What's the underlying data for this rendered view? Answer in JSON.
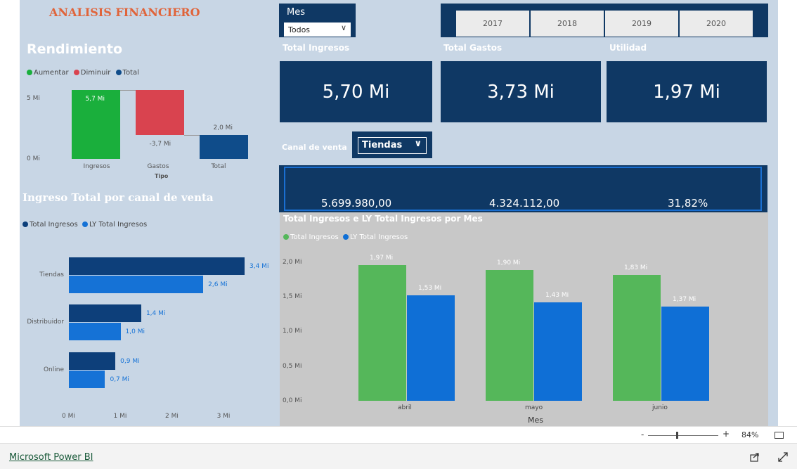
{
  "header": {
    "title": "ANALISIS  FINANCIERO"
  },
  "mes_slicer": {
    "label": "Mes",
    "selected": "Todos"
  },
  "years": [
    "2017",
    "2018",
    "2019",
    "2020"
  ],
  "kpis": {
    "ingresos": {
      "title": "Total Ingresos",
      "value": "5,70 Mi"
    },
    "gastos": {
      "title": "Total Gastos",
      "value": "3,73 Mi"
    },
    "utilidad": {
      "title": "Utilidad",
      "value": "1,97 Mi"
    }
  },
  "canal_slicer": {
    "label": "Canal de venta",
    "selected": "Tiendas"
  },
  "canal_values": [
    "5.699.980,00",
    "4.324.112,00",
    "31,82%"
  ],
  "rendimiento": {
    "title": "Rendimiento",
    "legend": [
      "Aumentar",
      "Diminuir",
      "Total"
    ],
    "y_ticks": [
      "5 Mi",
      "0 Mi"
    ],
    "xlabel": "Tipo"
  },
  "ingreso_canal": {
    "title": "Ingreso Total por canal de venta",
    "legend": [
      "Total Ingresos",
      "LY Total Ingresos"
    ],
    "x_ticks": [
      "0 Mi",
      "1 Mi",
      "2 Mi",
      "3 Mi"
    ]
  },
  "ingresos_mes": {
    "title": "Total Ingresos e LY Total Ingresos por Mes",
    "legend": [
      "Total Ingresos",
      "LY Total Ingresos"
    ],
    "y_ticks": [
      "2,0 Mi",
      "1,5 Mi",
      "1,0 Mi",
      "0,5 Mi",
      "0,0 Mi"
    ],
    "xlabel": "Mes"
  },
  "colors": {
    "navy": "#0f3864",
    "green": "#1aaf3c",
    "red": "#d9434f",
    "total_blue": "#0f4c8a",
    "dark_bar": "#0d3f7a",
    "light_bar": "#1572d6",
    "green_bar": "#55b75a",
    "blue_bar": "#0f6fd6"
  },
  "statusbar": {
    "zoom": "84%",
    "zoom_minus": "-",
    "zoom_plus": "+"
  },
  "footer": {
    "brand": "Microsoft Power BI"
  },
  "chart_data": [
    {
      "type": "bar",
      "title": "Rendimiento",
      "categories": [
        "Ingresos",
        "Gastos",
        "Total"
      ],
      "values": [
        5.7,
        -3.7,
        2.0
      ],
      "labels": [
        "5,7 Mi",
        "-3,7 Mi",
        "2,0 Mi"
      ],
      "xlabel": "Tipo",
      "ylim": [
        0,
        6
      ]
    },
    {
      "type": "bar",
      "title": "Ingreso Total por canal de venta",
      "categories": [
        "Tiendas",
        "Distribuidor",
        "Online"
      ],
      "series": [
        {
          "name": "Total Ingresos",
          "values": [
            3.4,
            1.4,
            0.9
          ],
          "labels": [
            "3,4 Mi",
            "1,4 Mi",
            "0,9 Mi"
          ]
        },
        {
          "name": "LY Total Ingresos",
          "values": [
            2.6,
            1.0,
            0.7
          ],
          "labels": [
            "2,6 Mi",
            "1,0 Mi",
            "0,7 Mi"
          ]
        }
      ],
      "xlim": [
        0,
        3.5
      ]
    },
    {
      "type": "bar",
      "title": "Total Ingresos e LY Total Ingresos por Mes",
      "categories": [
        "abril",
        "mayo",
        "junio"
      ],
      "series": [
        {
          "name": "Total Ingresos",
          "values": [
            1.97,
            1.9,
            1.83
          ],
          "labels": [
            "1,97 Mi",
            "1,90 Mi",
            "1,83 Mi"
          ]
        },
        {
          "name": "LY Total Ingresos",
          "values": [
            1.53,
            1.43,
            1.37
          ],
          "labels": [
            "1,53 Mi",
            "1,43 Mi",
            "1,37 Mi"
          ]
        }
      ],
      "xlabel": "Mes",
      "ylim": [
        0,
        2.0
      ]
    }
  ]
}
